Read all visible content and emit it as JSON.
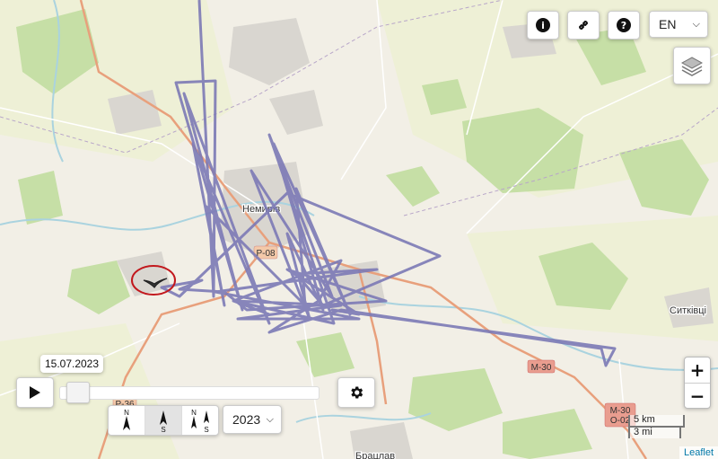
{
  "map": {
    "place_labels": [
      "Немирів",
      "Ситківці",
      "Брацлав"
    ],
    "road_labels": [
      "Р-08",
      "М-30",
      "Р-36",
      "М-30",
      "О-02"
    ],
    "track_color": "#7b79b5",
    "bird_marker_icon": "bird-icon"
  },
  "toolbar": {
    "info_icon": "info-icon",
    "link_icon": "link-icon",
    "help_icon": "help-icon",
    "language": "EN",
    "layers_icon": "layers-icon"
  },
  "timeline": {
    "date": "15.07.2023",
    "progress": 0.03,
    "year": "2023"
  },
  "north_buttons": [
    {
      "top": "N",
      "bottom": ""
    },
    {
      "top": "",
      "bottom": "S"
    },
    {
      "top": "N",
      "bottom": "S"
    }
  ],
  "zoom": {
    "in": "+",
    "out": "−"
  },
  "scale": {
    "km": "5 km",
    "mi": "3 mi"
  },
  "attribution": "Leaflet"
}
